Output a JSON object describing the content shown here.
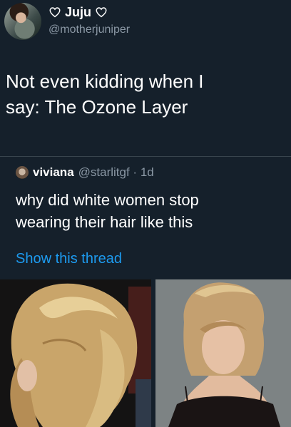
{
  "tweet": {
    "display_name": "Juju",
    "handle": "@motherjuniper",
    "text_line1": "Not even kidding when I",
    "text_line2": "say: The Ozone Layer"
  },
  "quoted_tweet": {
    "display_name": "viviana",
    "handle_time": "@starlitgf · 1d",
    "text_line1": "why did white women stop",
    "text_line2": "wearing their hair like this",
    "show_thread": "Show this thread"
  },
  "icons": {
    "name_left": "heart-outline-icon",
    "name_right": "heart-outline-icon"
  },
  "colors": {
    "background": "#15202b",
    "link": "#1d9bf0",
    "secondary_text": "#8b98a5"
  }
}
